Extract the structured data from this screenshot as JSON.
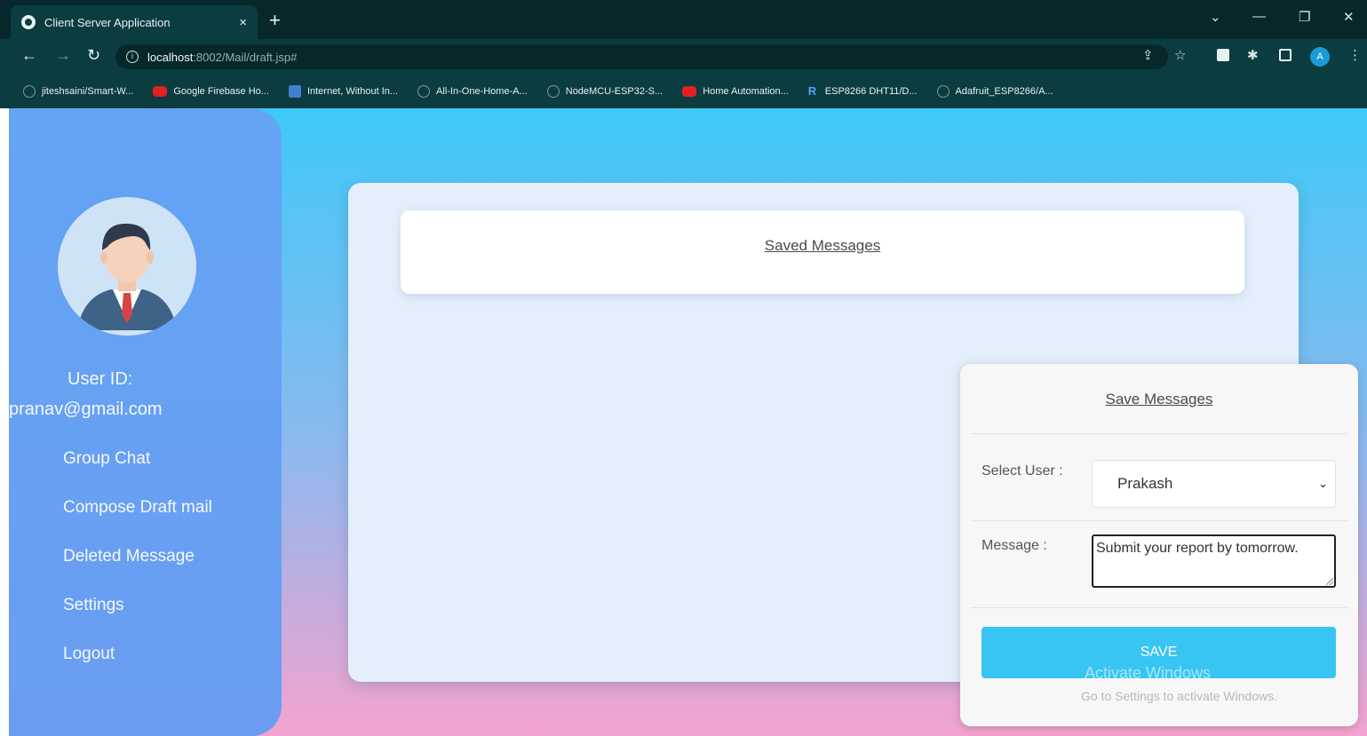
{
  "browser": {
    "tab_title": "Client Server Application",
    "tab_close": "×",
    "new_tab": "+",
    "url_host": "localhost",
    "url_rest": ":8002/Mail/draft.jsp#",
    "bookmarks": [
      {
        "label": "jiteshsaini/Smart-W...",
        "icon": "github-icon"
      },
      {
        "label": "Google Firebase Ho...",
        "icon": "youtube-icon"
      },
      {
        "label": "Internet, Without In...",
        "icon": "document-icon"
      },
      {
        "label": "All-In-One-Home-A...",
        "icon": "github-icon"
      },
      {
        "label": "NodeMCU-ESP32-S...",
        "icon": "github-icon"
      },
      {
        "label": "Home Automation...",
        "icon": "youtube-icon"
      },
      {
        "label": "ESP8266 DHT11/D...",
        "icon": "r-icon"
      },
      {
        "label": "Adafruit_ESP8266/A...",
        "icon": "github-icon"
      }
    ],
    "profile_initial": "A"
  },
  "sidebar": {
    "user_id_label": "User ID:",
    "user_email": "pranav@gmail.com",
    "nav": [
      {
        "label": "Group Chat"
      },
      {
        "label": "Compose Draft mail"
      },
      {
        "label": "Deleted Message"
      },
      {
        "label": "Settings"
      },
      {
        "label": "Logout"
      }
    ]
  },
  "main": {
    "saved_messages_title": "Saved Messages"
  },
  "save_panel": {
    "title": "Save Messages",
    "select_user_label": "Select User :",
    "selected_user": "Prakash",
    "message_label": "Message :",
    "message_value": "Submit your report by tomorrow.",
    "save_button": "SAVE"
  },
  "watermark": {
    "line1": "Activate Windows",
    "line2": "Go to Settings to activate Windows."
  },
  "colors": {
    "sidebar": "#6aa3f0",
    "accent": "#39c5f2",
    "chrome": "#0b3c40"
  }
}
